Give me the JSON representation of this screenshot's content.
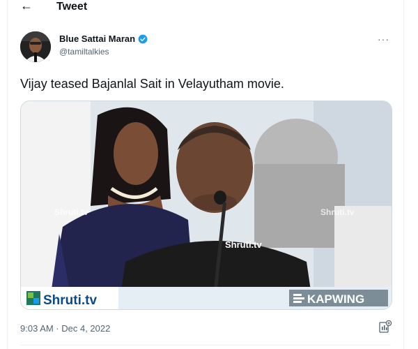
{
  "header": {
    "back_icon": "arrow-left-icon",
    "title": "Tweet"
  },
  "author": {
    "name": "Blue Sattai Maran",
    "handle": "@tamiltalkies",
    "verified_icon": "verified-badge-icon",
    "verified_color": "#1d9bf0"
  },
  "more_label": "···",
  "tweet": {
    "text": "Vijay teased Bajanlal Sait in Velayutham movie."
  },
  "media": {
    "watermarks": [
      "Shruti.tv",
      "Shruti.tv",
      "Shruti.tv"
    ],
    "logo_left": "Shruti.tv",
    "logo_right": "KAPWING"
  },
  "meta": {
    "timestamp": "9:03 AM · Dec 4, 2022",
    "analytics_icon": "analytics-icon"
  }
}
